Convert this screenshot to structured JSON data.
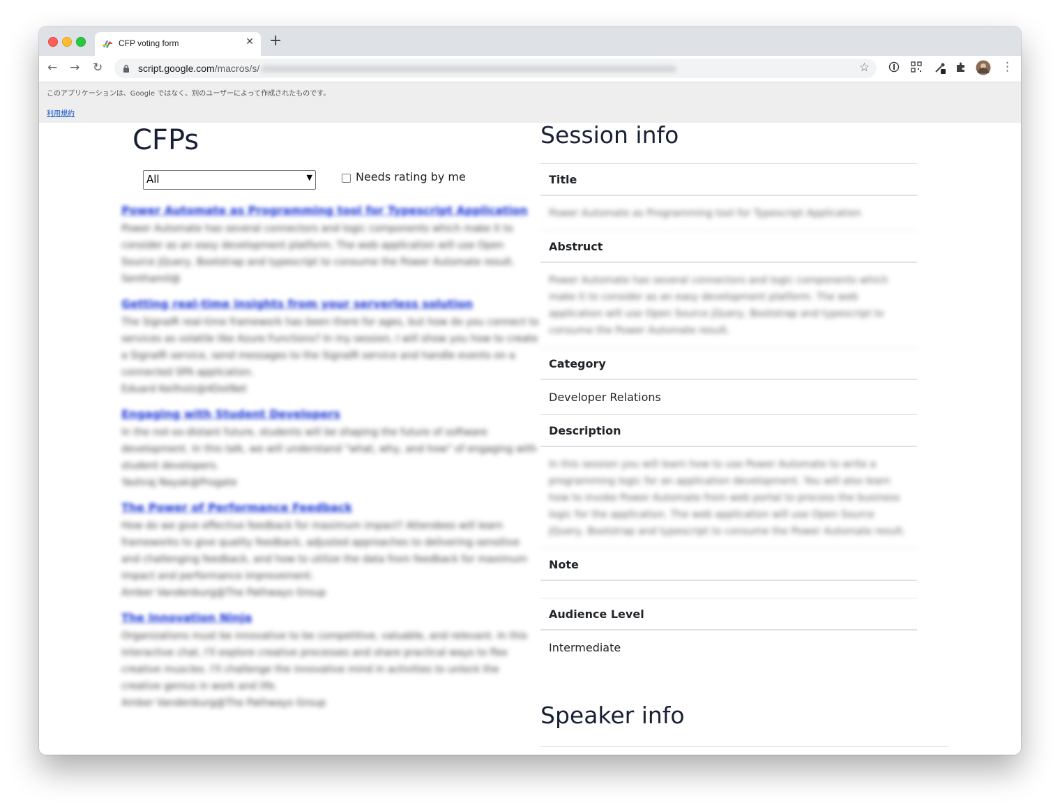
{
  "browser": {
    "tab_title": "CFP voting form",
    "url_host": "script.google.com",
    "url_path": "/macros/s/"
  },
  "banner": {
    "notice": "このアプリケーションは、Google ではなく、別のユーザーによって作成されたものです。",
    "terms_link": "利用規約"
  },
  "cfps": {
    "heading": "CFPs",
    "filter_value": "All",
    "needs_rating_label": "Needs rating by me",
    "items": [
      {
        "title": "Power Automate as Programming tool for Typescript Application",
        "description": "Power Automate has several connectors and logic components which make it to consider as an easy development platform. The web application will use Open Source jQuery, Bootstrap and typescript to consume the Power Automate result.",
        "author": "Senthamil@"
      },
      {
        "title": "Getting real-time insights from your serverless solution",
        "description": "The SignalR real-time framework has been there for ages, but how do you connect to services as volatile like Azure Functions? In my session, I will show you how to create a SignalR service, send messages to the SignalR service and handle events on a connected SPA application.",
        "author": "Eduard Keilholz@4DotNet"
      },
      {
        "title": "Engaging with Student Developers",
        "description": "In the not-so-distant future, students will be shaping the future of software development. In this talk, we will understand \"what, why, and how\" of engaging with student developers.",
        "author": "Yashraj Nayak@Progate"
      },
      {
        "title": "The Power of Performance Feedback",
        "description": "How do we give effective feedback for maximum impact? Attendees will learn frameworks to give quality feedback, adjusted approaches to delivering sensitive and challenging feedback, and how to utilize the data from feedback for maximum impact and performance improvement.",
        "author": "Amber Vandenburg@The Pathways Group"
      },
      {
        "title": "The Innovation Ninja",
        "description": "Organizations must be innovative to be competitive, valuable, and relevant. In this interactive chat, I'll explore creative processes and share practical ways to flex creative muscles. I'll challenge the innovative mind in activities to unlock the creative genius in work and life.",
        "author": "Amber Vandenburg@The Pathways Group"
      }
    ]
  },
  "session": {
    "heading": "Session info",
    "fields": [
      {
        "label": "Title",
        "value": "Power Automate as Programming tool for Typescript Application"
      },
      {
        "label": "Abstruct",
        "value": "Power Automate has several connectors and logic components which make it to consider as an easy development platform. The web application will use Open Source jQuery, Bootstrap and typescript to consume the Power Automate result."
      },
      {
        "label": "Category",
        "value": "Developer Relations"
      },
      {
        "label": "Description",
        "value": "In this session you will learn how to use Power Automate to write a programming logic for an application development. You will also learn how to invoke Power Automate from web portal to process the business logic for the application. The web application will use Open Source jQuery, Bootstrap and typescript to consume the Power Automate result."
      },
      {
        "label": "Note",
        "value": ""
      },
      {
        "label": "Audience Level",
        "value": "Intermediate"
      }
    ]
  },
  "speaker": {
    "heading": "Speaker info"
  }
}
